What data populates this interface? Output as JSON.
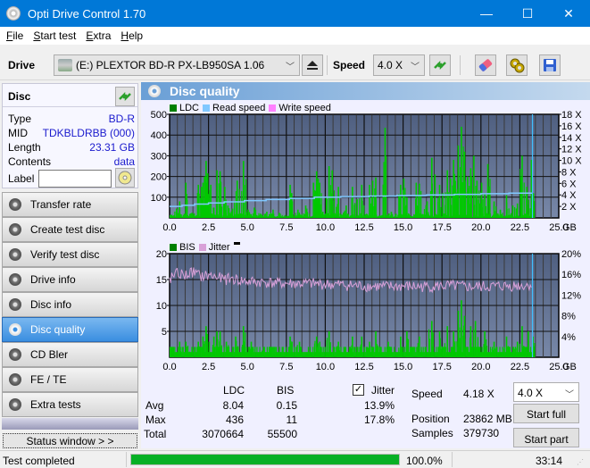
{
  "window": {
    "title": "Opti Drive Control 1.70",
    "minimize": "—",
    "maximize": "☐",
    "close": "✕"
  },
  "menu": [
    {
      "label": "File",
      "accel": "F",
      "rest": "ile"
    },
    {
      "label": "Start test",
      "accel": "S",
      "rest": "tart test"
    },
    {
      "label": "Extra",
      "accel": "E",
      "rest": "xtra"
    },
    {
      "label": "Help",
      "accel": "H",
      "rest": "elp"
    }
  ],
  "toolbar": {
    "drive_label": "Drive",
    "drive_value": "(E:)  PLEXTOR BD-R  PX-LB950SA 1.06",
    "speed_label": "Speed",
    "speed_value": "4.0 X",
    "icons": [
      "eject-icon",
      "refresh-icon",
      "eraser-icon",
      "settings-icon",
      "save-icon"
    ]
  },
  "disc": {
    "header": "Disc",
    "rows": [
      {
        "key": "Type",
        "value": "BD-R"
      },
      {
        "key": "MID",
        "value": "TDKBLDRBB (000)"
      },
      {
        "key": "Length",
        "value": "23.31 GB"
      },
      {
        "key": "Contents",
        "value": "data"
      }
    ],
    "label_key": "Label",
    "label_value": ""
  },
  "nav": [
    {
      "label": "Transfer rate",
      "active": false
    },
    {
      "label": "Create test disc",
      "active": false
    },
    {
      "label": "Verify test disc",
      "active": false
    },
    {
      "label": "Drive info",
      "active": false
    },
    {
      "label": "Disc info",
      "active": false
    },
    {
      "label": "Disc quality",
      "active": true
    },
    {
      "label": "CD Bler",
      "active": false
    },
    {
      "label": "FE / TE",
      "active": false
    },
    {
      "label": "Extra tests",
      "active": false
    }
  ],
  "status_window_label": "Status window > >",
  "panel_title": "Disc quality",
  "colors": {
    "ldc": "#00c800",
    "read_speed": "#80c8ff",
    "write_speed": "#ff80ff",
    "bis": "#00c800",
    "jitter": "#d8a0d8",
    "plot_bg_top": "#4f5f80",
    "plot_bg_bottom": "#7888a8",
    "accent": "#0078d7",
    "value_blue": "#1a1acd"
  },
  "chart_data": [
    {
      "type": "bar",
      "title": "LDC / Read speed",
      "legend": [
        "LDC",
        "Read speed",
        "Write speed"
      ],
      "legend_position": "top-left",
      "x_ticks": [
        "0.0",
        "2.5",
        "5.0",
        "7.5",
        "10.0",
        "12.5",
        "15.0",
        "17.5",
        "20.0",
        "22.5",
        "25.0"
      ],
      "x_unit": "GB",
      "xlim": [
        0,
        25
      ],
      "y_ticks": [
        "100",
        "200",
        "300",
        "400",
        "500"
      ],
      "ylim": [
        0,
        500
      ],
      "y2_ticks": [
        "2 X",
        "4 X",
        "6 X",
        "8 X",
        "10 X",
        "12 X",
        "14 X",
        "16 X",
        "18 X"
      ],
      "y2lim": [
        0,
        18
      ],
      "grid": true,
      "ldc_peaks": [
        {
          "x": 0.1,
          "y": 15
        },
        {
          "x": 0.4,
          "y": 45
        },
        {
          "x": 0.6,
          "y": 80
        },
        {
          "x": 0.9,
          "y": 20
        },
        {
          "x": 1.0,
          "y": 170
        },
        {
          "x": 1.4,
          "y": 25
        },
        {
          "x": 1.8,
          "y": 160
        },
        {
          "x": 2.0,
          "y": 150
        },
        {
          "x": 2.1,
          "y": 170
        },
        {
          "x": 2.2,
          "y": 200
        },
        {
          "x": 2.3,
          "y": 275
        },
        {
          "x": 2.4,
          "y": 215
        },
        {
          "x": 2.6,
          "y": 160
        },
        {
          "x": 2.8,
          "y": 50
        },
        {
          "x": 3.0,
          "y": 230
        },
        {
          "x": 3.2,
          "y": 225
        },
        {
          "x": 3.5,
          "y": 150
        },
        {
          "x": 3.7,
          "y": 60
        },
        {
          "x": 4.0,
          "y": 45
        },
        {
          "x": 4.3,
          "y": 180
        },
        {
          "x": 4.7,
          "y": 275
        },
        {
          "x": 5.0,
          "y": 40
        },
        {
          "x": 5.4,
          "y": 50
        },
        {
          "x": 5.8,
          "y": 20
        },
        {
          "x": 6.2,
          "y": 30
        },
        {
          "x": 6.6,
          "y": 40
        },
        {
          "x": 7.0,
          "y": 25
        },
        {
          "x": 7.7,
          "y": 160
        },
        {
          "x": 7.8,
          "y": 120
        },
        {
          "x": 8.2,
          "y": 40
        },
        {
          "x": 8.7,
          "y": 60
        },
        {
          "x": 9.2,
          "y": 170
        },
        {
          "x": 9.4,
          "y": 225
        },
        {
          "x": 9.5,
          "y": 190
        },
        {
          "x": 9.6,
          "y": 170
        },
        {
          "x": 9.8,
          "y": 30
        },
        {
          "x": 10.2,
          "y": 250
        },
        {
          "x": 10.4,
          "y": 230
        },
        {
          "x": 10.8,
          "y": 150
        },
        {
          "x": 11.3,
          "y": 60
        },
        {
          "x": 11.7,
          "y": 150
        },
        {
          "x": 12.0,
          "y": 90
        },
        {
          "x": 12.3,
          "y": 160
        },
        {
          "x": 12.6,
          "y": 20
        },
        {
          "x": 12.8,
          "y": 160
        },
        {
          "x": 13.0,
          "y": 180
        },
        {
          "x": 13.2,
          "y": 195
        },
        {
          "x": 13.8,
          "y": 435
        },
        {
          "x": 14.2,
          "y": 30
        },
        {
          "x": 14.8,
          "y": 160
        },
        {
          "x": 15.0,
          "y": 190
        },
        {
          "x": 15.2,
          "y": 100
        },
        {
          "x": 15.8,
          "y": 170
        },
        {
          "x": 16.0,
          "y": 165
        },
        {
          "x": 16.5,
          "y": 80
        },
        {
          "x": 16.8,
          "y": 290
        },
        {
          "x": 17.0,
          "y": 210
        },
        {
          "x": 17.3,
          "y": 160
        },
        {
          "x": 17.5,
          "y": 120
        },
        {
          "x": 17.8,
          "y": 230
        },
        {
          "x": 18.0,
          "y": 190
        },
        {
          "x": 18.2,
          "y": 280
        },
        {
          "x": 18.5,
          "y": 350
        },
        {
          "x": 18.7,
          "y": 440
        },
        {
          "x": 18.9,
          "y": 320
        },
        {
          "x": 19.1,
          "y": 200
        },
        {
          "x": 19.3,
          "y": 240
        },
        {
          "x": 19.5,
          "y": 300
        },
        {
          "x": 19.7,
          "y": 180
        },
        {
          "x": 20.0,
          "y": 170
        },
        {
          "x": 20.2,
          "y": 120
        },
        {
          "x": 20.4,
          "y": 260
        },
        {
          "x": 20.8,
          "y": 80
        },
        {
          "x": 21.2,
          "y": 40
        },
        {
          "x": 21.6,
          "y": 110
        },
        {
          "x": 22.0,
          "y": 60
        },
        {
          "x": 22.3,
          "y": 70
        },
        {
          "x": 22.6,
          "y": 300
        },
        {
          "x": 22.9,
          "y": 150
        },
        {
          "x": 23.2,
          "y": 280
        },
        {
          "x": 23.3,
          "y": 120
        }
      ],
      "read_speed_steps": [
        {
          "x": 0.0,
          "speed": 2.0
        },
        {
          "x": 0.8,
          "speed": 2.2
        },
        {
          "x": 1.6,
          "speed": 2.4
        },
        {
          "x": 2.5,
          "speed": 2.6
        },
        {
          "x": 3.5,
          "speed": 2.8
        },
        {
          "x": 4.8,
          "speed": 3.0
        },
        {
          "x": 6.2,
          "speed": 3.2
        },
        {
          "x": 7.7,
          "speed": 3.4
        },
        {
          "x": 9.3,
          "speed": 3.6
        },
        {
          "x": 11.0,
          "speed": 3.7
        },
        {
          "x": 12.8,
          "speed": 3.8
        },
        {
          "x": 14.6,
          "speed": 3.9
        },
        {
          "x": 16.5,
          "speed": 4.0
        },
        {
          "x": 18.3,
          "speed": 4.1
        },
        {
          "x": 20.0,
          "speed": 4.2
        },
        {
          "x": 21.8,
          "speed": 4.3
        },
        {
          "x": 23.31,
          "speed": 4.3
        }
      ],
      "end_marker_x": 23.31
    },
    {
      "type": "bar",
      "title": "BIS / Jitter",
      "legend": [
        "BIS",
        "Jitter"
      ],
      "legend_position": "top-left",
      "x_ticks": [
        "0.0",
        "2.5",
        "5.0",
        "7.5",
        "10.0",
        "12.5",
        "15.0",
        "17.5",
        "20.0",
        "22.5",
        "25.0"
      ],
      "x_unit": "GB",
      "xlim": [
        0,
        25
      ],
      "y_ticks": [
        "5",
        "10",
        "15",
        "20"
      ],
      "ylim": [
        0,
        20
      ],
      "y2_ticks": [
        "4%",
        "8%",
        "12%",
        "16%",
        "20%"
      ],
      "y2lim": [
        0,
        20
      ],
      "grid": true,
      "bis_peaks": [
        {
          "x": 0.2,
          "y": 2
        },
        {
          "x": 0.6,
          "y": 3
        },
        {
          "x": 1.0,
          "y": 3
        },
        {
          "x": 1.4,
          "y": 2
        },
        {
          "x": 1.8,
          "y": 3
        },
        {
          "x": 2.1,
          "y": 4
        },
        {
          "x": 2.3,
          "y": 6
        },
        {
          "x": 2.5,
          "y": 3
        },
        {
          "x": 2.8,
          "y": 4
        },
        {
          "x": 3.0,
          "y": 5
        },
        {
          "x": 3.2,
          "y": 5
        },
        {
          "x": 3.6,
          "y": 3
        },
        {
          "x": 4.2,
          "y": 4
        },
        {
          "x": 4.7,
          "y": 6
        },
        {
          "x": 5.2,
          "y": 3
        },
        {
          "x": 6.0,
          "y": 2
        },
        {
          "x": 6.8,
          "y": 2
        },
        {
          "x": 7.7,
          "y": 4
        },
        {
          "x": 8.3,
          "y": 3
        },
        {
          "x": 9.4,
          "y": 4
        },
        {
          "x": 9.6,
          "y": 3
        },
        {
          "x": 10.2,
          "y": 5
        },
        {
          "x": 10.8,
          "y": 3
        },
        {
          "x": 11.7,
          "y": 4
        },
        {
          "x": 12.3,
          "y": 4
        },
        {
          "x": 12.8,
          "y": 3
        },
        {
          "x": 13.2,
          "y": 5
        },
        {
          "x": 14.0,
          "y": 3
        },
        {
          "x": 14.8,
          "y": 4
        },
        {
          "x": 15.2,
          "y": 5
        },
        {
          "x": 16.0,
          "y": 4
        },
        {
          "x": 16.8,
          "y": 7
        },
        {
          "x": 17.3,
          "y": 5
        },
        {
          "x": 17.8,
          "y": 6
        },
        {
          "x": 18.2,
          "y": 5
        },
        {
          "x": 18.5,
          "y": 9
        },
        {
          "x": 18.7,
          "y": 11
        },
        {
          "x": 18.9,
          "y": 8
        },
        {
          "x": 19.3,
          "y": 6
        },
        {
          "x": 19.6,
          "y": 7
        },
        {
          "x": 20.2,
          "y": 5
        },
        {
          "x": 20.8,
          "y": 3
        },
        {
          "x": 21.6,
          "y": 4
        },
        {
          "x": 22.3,
          "y": 3
        },
        {
          "x": 22.6,
          "y": 6
        },
        {
          "x": 23.0,
          "y": 5
        },
        {
          "x": 23.3,
          "y": 4
        }
      ],
      "jitter_percent": [
        {
          "x": 0.0,
          "y": 15.0
        },
        {
          "x": 0.5,
          "y": 16.2
        },
        {
          "x": 1.0,
          "y": 15.8
        },
        {
          "x": 1.5,
          "y": 16.5
        },
        {
          "x": 2.0,
          "y": 15.6
        },
        {
          "x": 2.5,
          "y": 15.8
        },
        {
          "x": 3.0,
          "y": 15.5
        },
        {
          "x": 3.5,
          "y": 15.0
        },
        {
          "x": 4.0,
          "y": 15.2
        },
        {
          "x": 4.5,
          "y": 14.8
        },
        {
          "x": 5.0,
          "y": 14.6
        },
        {
          "x": 6.0,
          "y": 14.5
        },
        {
          "x": 7.0,
          "y": 14.3
        },
        {
          "x": 8.0,
          "y": 14.2
        },
        {
          "x": 9.0,
          "y": 14.2
        },
        {
          "x": 10.0,
          "y": 14.1
        },
        {
          "x": 11.0,
          "y": 14.0
        },
        {
          "x": 12.0,
          "y": 13.8
        },
        {
          "x": 13.0,
          "y": 13.7
        },
        {
          "x": 14.0,
          "y": 13.6
        },
        {
          "x": 15.0,
          "y": 13.7
        },
        {
          "x": 16.0,
          "y": 13.6
        },
        {
          "x": 17.0,
          "y": 13.7
        },
        {
          "x": 18.0,
          "y": 13.8
        },
        {
          "x": 19.0,
          "y": 13.6
        },
        {
          "x": 20.0,
          "y": 13.6
        },
        {
          "x": 21.0,
          "y": 13.7
        },
        {
          "x": 22.0,
          "y": 13.8
        },
        {
          "x": 23.0,
          "y": 13.9
        },
        {
          "x": 23.31,
          "y": 14.2
        }
      ],
      "end_marker_x": 23.31
    }
  ],
  "stats": {
    "col_ldc": "LDC",
    "col_bis": "BIS",
    "jitter_checkbox_label": "Jitter",
    "jitter_checked": true,
    "rows": [
      {
        "label": "Avg",
        "ldc": "8.04",
        "bis": "0.15",
        "jitter": "13.9%"
      },
      {
        "label": "Max",
        "ldc": "436",
        "bis": "11",
        "jitter": "17.8%"
      },
      {
        "label": "Total",
        "ldc": "3070664",
        "bis": "55500",
        "jitter": ""
      }
    ],
    "speed_label": "Speed",
    "speed_value": "4.18 X",
    "position_label": "Position",
    "position_value": "23862 MB",
    "samples_label": "Samples",
    "samples_value": "379730",
    "speed_select": "4.0 X",
    "start_full": "Start full",
    "start_part": "Start part"
  },
  "statusbar": {
    "text": "Test completed",
    "progress_percent": 100.0,
    "progress_label": "100.0%",
    "elapsed": "33:14"
  }
}
